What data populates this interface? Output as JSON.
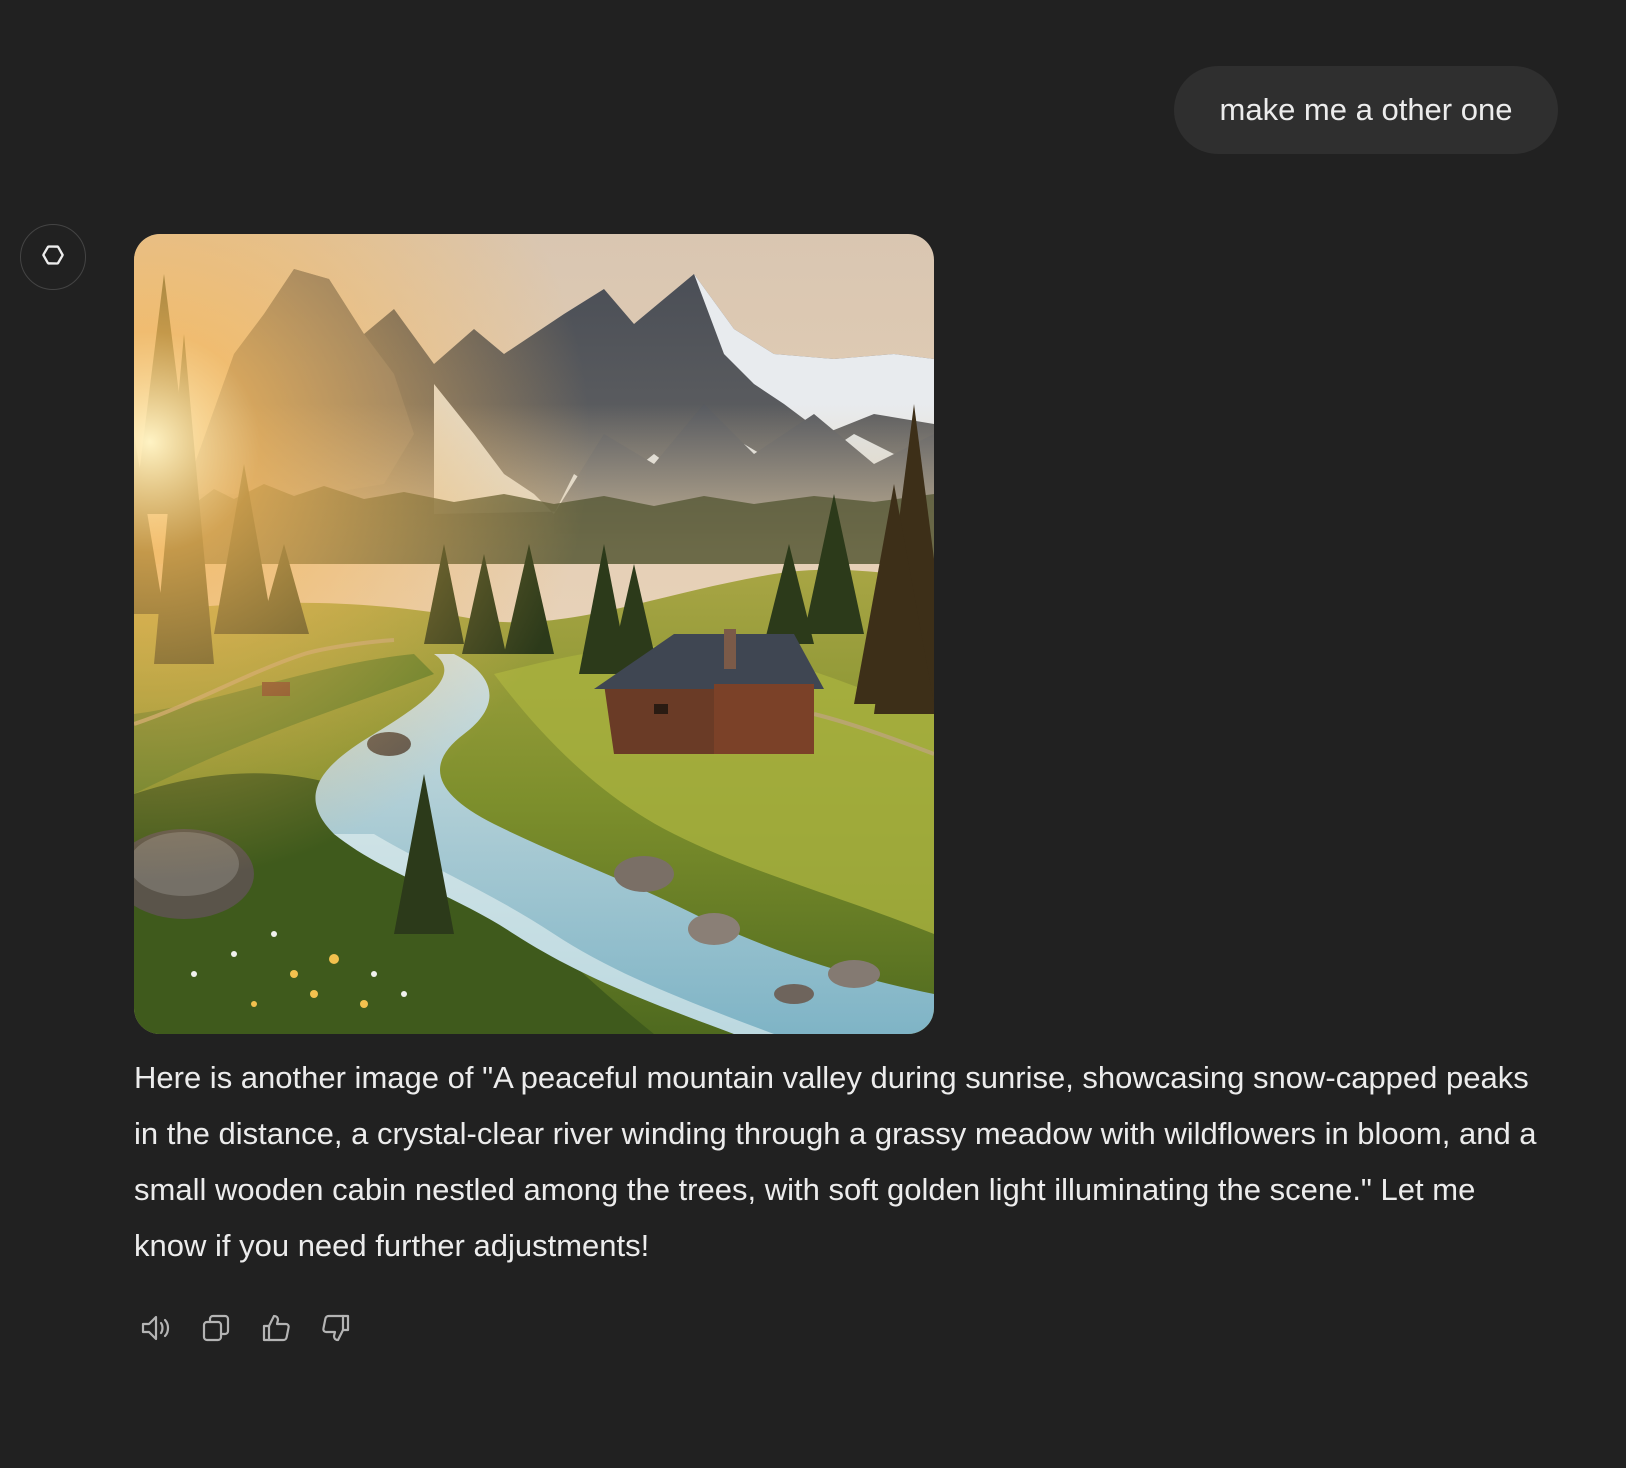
{
  "user_message": {
    "text": "make me a other one"
  },
  "assistant": {
    "avatar_icon": "openai-logo-icon",
    "image": {
      "alt": "Mountain valley at sunrise with snow-capped peaks, a river through a grassy meadow, and a small wooden cabin"
    },
    "response_text": "Here is another image of \"A peaceful mountain valley during sunrise, showcasing snow-capped peaks in the distance, a crystal-clear river winding through a grassy meadow with wildflowers in bloom, and a small wooden cabin nestled among the trees, with soft golden light illuminating the scene.\" Let me know if you need further adjustments!",
    "actions": [
      {
        "name": "read-aloud",
        "icon": "speaker-icon"
      },
      {
        "name": "copy",
        "icon": "copy-icon"
      },
      {
        "name": "good-response",
        "icon": "thumbs-up-icon"
      },
      {
        "name": "bad-response",
        "icon": "thumbs-down-icon"
      }
    ]
  },
  "colors": {
    "background": "#212121",
    "user_bubble": "#2f2f2f",
    "text": "#ececec",
    "icon": "#b4b4b4"
  }
}
